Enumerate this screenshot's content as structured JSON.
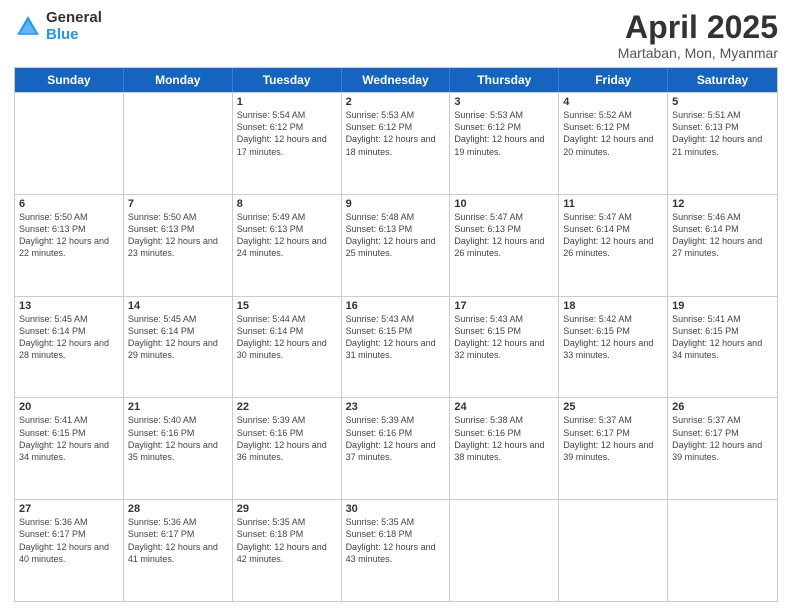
{
  "logo": {
    "general": "General",
    "blue": "Blue"
  },
  "title": {
    "month": "April 2025",
    "location": "Martaban, Mon, Myanmar"
  },
  "calendar": {
    "headers": [
      "Sunday",
      "Monday",
      "Tuesday",
      "Wednesday",
      "Thursday",
      "Friday",
      "Saturday"
    ],
    "rows": [
      [
        {
          "day": "",
          "info": ""
        },
        {
          "day": "",
          "info": ""
        },
        {
          "day": "1",
          "info": "Sunrise: 5:54 AM\nSunset: 6:12 PM\nDaylight: 12 hours and 17 minutes."
        },
        {
          "day": "2",
          "info": "Sunrise: 5:53 AM\nSunset: 6:12 PM\nDaylight: 12 hours and 18 minutes."
        },
        {
          "day": "3",
          "info": "Sunrise: 5:53 AM\nSunset: 6:12 PM\nDaylight: 12 hours and 19 minutes."
        },
        {
          "day": "4",
          "info": "Sunrise: 5:52 AM\nSunset: 6:12 PM\nDaylight: 12 hours and 20 minutes."
        },
        {
          "day": "5",
          "info": "Sunrise: 5:51 AM\nSunset: 6:13 PM\nDaylight: 12 hours and 21 minutes."
        }
      ],
      [
        {
          "day": "6",
          "info": "Sunrise: 5:50 AM\nSunset: 6:13 PM\nDaylight: 12 hours and 22 minutes."
        },
        {
          "day": "7",
          "info": "Sunrise: 5:50 AM\nSunset: 6:13 PM\nDaylight: 12 hours and 23 minutes."
        },
        {
          "day": "8",
          "info": "Sunrise: 5:49 AM\nSunset: 6:13 PM\nDaylight: 12 hours and 24 minutes."
        },
        {
          "day": "9",
          "info": "Sunrise: 5:48 AM\nSunset: 6:13 PM\nDaylight: 12 hours and 25 minutes."
        },
        {
          "day": "10",
          "info": "Sunrise: 5:47 AM\nSunset: 6:13 PM\nDaylight: 12 hours and 26 minutes."
        },
        {
          "day": "11",
          "info": "Sunrise: 5:47 AM\nSunset: 6:14 PM\nDaylight: 12 hours and 26 minutes."
        },
        {
          "day": "12",
          "info": "Sunrise: 5:46 AM\nSunset: 6:14 PM\nDaylight: 12 hours and 27 minutes."
        }
      ],
      [
        {
          "day": "13",
          "info": "Sunrise: 5:45 AM\nSunset: 6:14 PM\nDaylight: 12 hours and 28 minutes."
        },
        {
          "day": "14",
          "info": "Sunrise: 5:45 AM\nSunset: 6:14 PM\nDaylight: 12 hours and 29 minutes."
        },
        {
          "day": "15",
          "info": "Sunrise: 5:44 AM\nSunset: 6:14 PM\nDaylight: 12 hours and 30 minutes."
        },
        {
          "day": "16",
          "info": "Sunrise: 5:43 AM\nSunset: 6:15 PM\nDaylight: 12 hours and 31 minutes."
        },
        {
          "day": "17",
          "info": "Sunrise: 5:43 AM\nSunset: 6:15 PM\nDaylight: 12 hours and 32 minutes."
        },
        {
          "day": "18",
          "info": "Sunrise: 5:42 AM\nSunset: 6:15 PM\nDaylight: 12 hours and 33 minutes."
        },
        {
          "day": "19",
          "info": "Sunrise: 5:41 AM\nSunset: 6:15 PM\nDaylight: 12 hours and 34 minutes."
        }
      ],
      [
        {
          "day": "20",
          "info": "Sunrise: 5:41 AM\nSunset: 6:15 PM\nDaylight: 12 hours and 34 minutes."
        },
        {
          "day": "21",
          "info": "Sunrise: 5:40 AM\nSunset: 6:16 PM\nDaylight: 12 hours and 35 minutes."
        },
        {
          "day": "22",
          "info": "Sunrise: 5:39 AM\nSunset: 6:16 PM\nDaylight: 12 hours and 36 minutes."
        },
        {
          "day": "23",
          "info": "Sunrise: 5:39 AM\nSunset: 6:16 PM\nDaylight: 12 hours and 37 minutes."
        },
        {
          "day": "24",
          "info": "Sunrise: 5:38 AM\nSunset: 6:16 PM\nDaylight: 12 hours and 38 minutes."
        },
        {
          "day": "25",
          "info": "Sunrise: 5:37 AM\nSunset: 6:17 PM\nDaylight: 12 hours and 39 minutes."
        },
        {
          "day": "26",
          "info": "Sunrise: 5:37 AM\nSunset: 6:17 PM\nDaylight: 12 hours and 39 minutes."
        }
      ],
      [
        {
          "day": "27",
          "info": "Sunrise: 5:36 AM\nSunset: 6:17 PM\nDaylight: 12 hours and 40 minutes."
        },
        {
          "day": "28",
          "info": "Sunrise: 5:36 AM\nSunset: 6:17 PM\nDaylight: 12 hours and 41 minutes."
        },
        {
          "day": "29",
          "info": "Sunrise: 5:35 AM\nSunset: 6:18 PM\nDaylight: 12 hours and 42 minutes."
        },
        {
          "day": "30",
          "info": "Sunrise: 5:35 AM\nSunset: 6:18 PM\nDaylight: 12 hours and 43 minutes."
        },
        {
          "day": "",
          "info": ""
        },
        {
          "day": "",
          "info": ""
        },
        {
          "day": "",
          "info": ""
        }
      ]
    ]
  }
}
